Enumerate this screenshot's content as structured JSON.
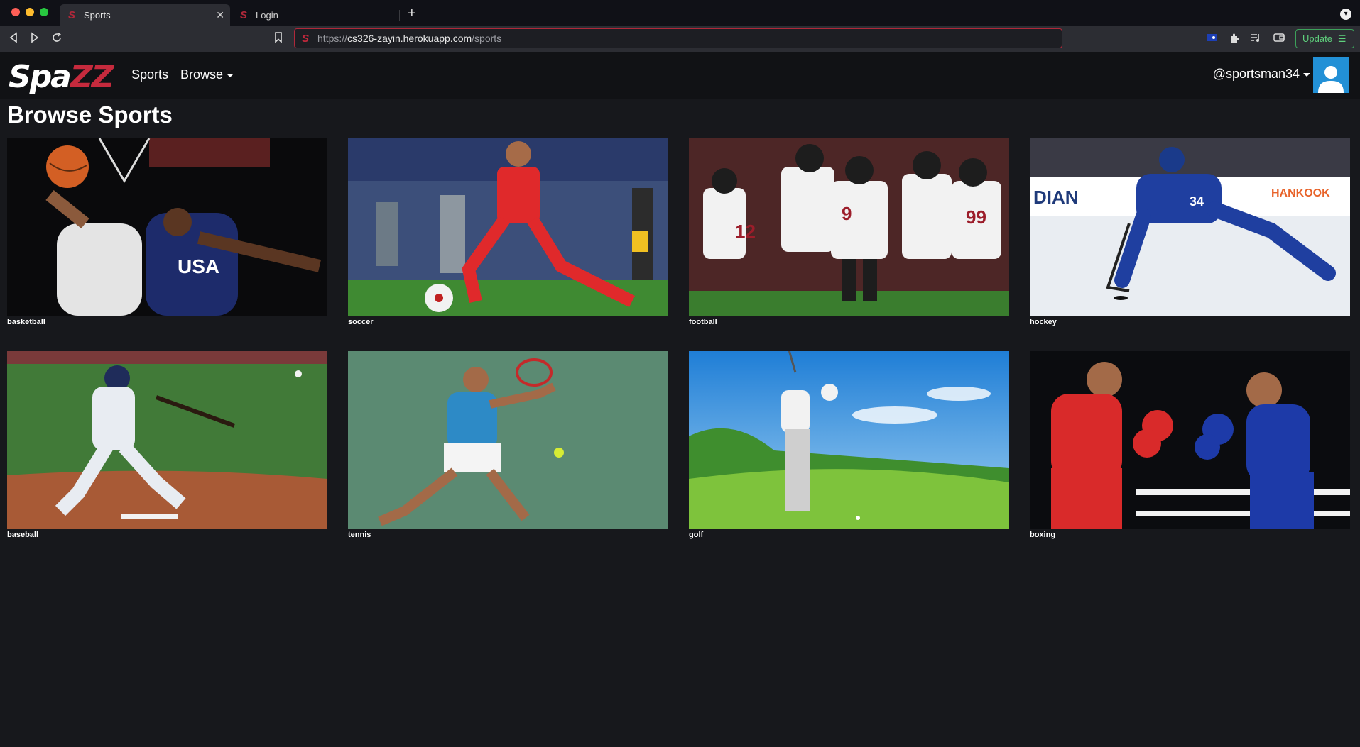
{
  "browser": {
    "tabs": [
      {
        "title": "Sports",
        "active": true
      },
      {
        "title": "Login",
        "active": false
      }
    ],
    "url": {
      "protocol": "https://",
      "host": "cs326-zayin.herokuapp.com",
      "path": "/sports"
    },
    "update_label": "Update"
  },
  "site": {
    "logo_main": "Spa",
    "logo_accent": "ZZ",
    "nav": {
      "sports": "Sports",
      "browse": "Browse"
    },
    "username": "@sportsman34"
  },
  "page_title": "Browse Sports",
  "sports": [
    {
      "label": "basketball"
    },
    {
      "label": "soccer"
    },
    {
      "label": "football"
    },
    {
      "label": "hockey"
    },
    {
      "label": "baseball"
    },
    {
      "label": "tennis"
    },
    {
      "label": "golf"
    },
    {
      "label": "boxing"
    }
  ],
  "colors": {
    "brand_red": "#c62a3d",
    "avatar_blue": "#2290d6",
    "update_green": "#5fd17d"
  }
}
